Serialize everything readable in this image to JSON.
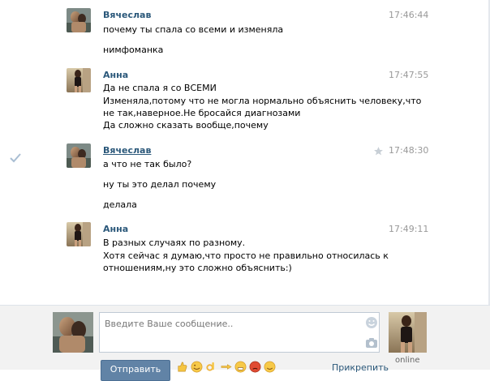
{
  "messages": [
    {
      "author": "Вячеслав",
      "time": "17:46:44",
      "lines": [
        "почему ты спала со всеми и изменяла",
        "нимфоманка"
      ]
    },
    {
      "author": "Анна",
      "time": "17:47:55",
      "lines": [
        "Да не спала я со ВСЕМИ",
        "Изменяла,потому что не могла нормально объяснить человеку,что",
        "не так,наверное.Не бросайся диагнозами",
        "Да сложно сказать вообще,почему"
      ]
    },
    {
      "author": "Вячеслав",
      "time": "17:48:30",
      "lines": [
        "а что не так было?",
        "ну ты это делал почему",
        "делала"
      ]
    },
    {
      "author": "Анна",
      "time": "17:49:11",
      "lines": [
        "В разных случаях по разному.",
        "Хотя сейчас я думаю,что просто не правильно относилась к",
        "отношениям,ну это сложно объяснить:)"
      ]
    }
  ],
  "composer": {
    "placeholder": "Введите Ваше сообщение..",
    "send_label": "Отправить",
    "attach_label": "Прикрепить",
    "peer_status": "online"
  },
  "icons": {
    "check": "checkmark-icon",
    "star": "star-icon",
    "smile": "smile-icon",
    "camera": "camera-icon"
  },
  "colors": {
    "author": "#2b587a",
    "timestamp": "#999999",
    "send_button": "#6183a6",
    "composer_bg": "#f2f2f2"
  }
}
